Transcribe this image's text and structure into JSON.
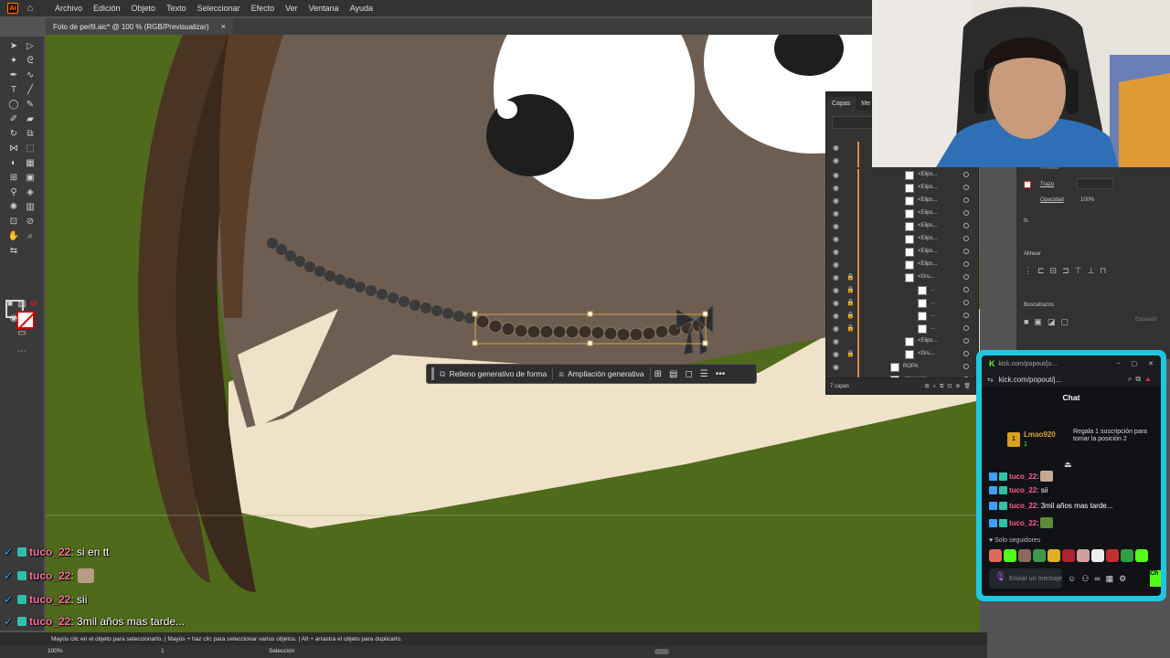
{
  "menubar": {
    "app_logo": "Ai",
    "items": [
      "Archivo",
      "Edición",
      "Objeto",
      "Texto",
      "Seleccionar",
      "Efecto",
      "Ver",
      "Ventana",
      "Ayuda"
    ]
  },
  "document_tab": {
    "title": "Foto de perfil.aic* @ 100 % (RGB/Previsualizar)",
    "close": "×"
  },
  "context_bar": {
    "btn1": "Relleno generativo de forma",
    "btn2": "Ampliación generativa",
    "more": "•••"
  },
  "layers_panel": {
    "tabs": [
      "Capas",
      "Me"
    ],
    "rows": [
      {
        "name": "<Elips...",
        "type": "ellipse"
      },
      {
        "name": "<Elips...",
        "type": "ellipse"
      },
      {
        "name": "<Elips...",
        "type": "ellipse"
      },
      {
        "name": "<Elips...",
        "type": "ellipse"
      },
      {
        "name": "<Elips...",
        "type": "ellipse"
      },
      {
        "name": "<Elips...",
        "type": "ellipse"
      },
      {
        "name": "<Elips...",
        "type": "ellipse"
      },
      {
        "name": "<Elips...",
        "type": "ellipse"
      },
      {
        "name": "<Gru...",
        "type": "group"
      },
      {
        "name": "...",
        "type": "path"
      },
      {
        "name": "...",
        "type": "path"
      },
      {
        "name": "...",
        "type": "path"
      },
      {
        "name": "...",
        "type": "path"
      },
      {
        "name": "<Elips...",
        "type": "ellipse"
      },
      {
        "name": "<Gru...",
        "type": "group"
      },
      {
        "name": "ROPA",
        "type": "layer"
      },
      {
        "name": "<Imagen>",
        "type": "image"
      }
    ],
    "footer_count": "7 capas"
  },
  "properties_panel": {
    "relleno_label": "Relleno",
    "trazo_label": "Trazo",
    "opacidad_label": "Opacidad",
    "opacidad_value": "100%",
    "fx_label": "fx.",
    "alinear_label": "Alinear",
    "buscatrazos_label": "Buscatrazos",
    "expandir_label": "Expandir"
  },
  "chat_window": {
    "titlebar_url": "kick.com/popout/ju...",
    "address": "kick.com/popout/j...",
    "title": "Chat",
    "gift_user": "Lmao920",
    "gift_count": "1",
    "gift_text": "Regala 1 suscripción para tomar la posición 2",
    "messages": [
      {
        "user": "tuco_22",
        "text": "",
        "emote": true
      },
      {
        "user": "tuco_22",
        "text": "sii",
        "emote": false
      },
      {
        "user": "tuco_22",
        "text": "3mil años mas tarde...",
        "emote": false
      },
      {
        "user": "tuco_22",
        "text": "",
        "emote": true
      }
    ],
    "follow_only": "Solo seguidores",
    "send_placeholder": "Enviar un mensaje",
    "send_button": "Ch"
  },
  "overlay_chat": [
    {
      "user": "tuco_22",
      "text": "si en tt",
      "emote": false
    },
    {
      "user": "tuco_22",
      "text": "",
      "emote": true
    },
    {
      "user": "tuco_22",
      "text": "sii",
      "emote": false
    },
    {
      "user": "tuco_22",
      "text": "3mil años mas tarde...",
      "emote": false
    },
    {
      "user": "tuco_22",
      "text": "",
      "emote": true
    }
  ],
  "statusbar": {
    "hint": "Mayús clic en el objeto para seleccionarlo.  |  Mayús + haz clic para seleccionar varios objetos.  |  Alt + arrastra el objeto para duplicarlo.",
    "zoom": "100%",
    "artboard": "1",
    "mode": "Selección"
  },
  "colors": {
    "canvas_green": "#4f6a1a",
    "face_brown": "#6e5e52",
    "hair_brown": "#4a3423",
    "skin_cream": "#efe2c8",
    "kick_green": "#53fc18",
    "chat_border": "#1fc7e0"
  }
}
